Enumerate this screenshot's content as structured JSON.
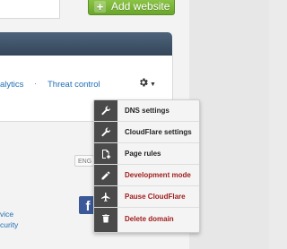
{
  "header": {
    "add_website_label": "Add website",
    "add_icon": "plus-icon"
  },
  "nav": {
    "analytics_link": "alytics",
    "separator": "·",
    "threat_control_link": "Threat control",
    "settings_icon": "gear-icon",
    "caret_icon": "chevron-down-icon"
  },
  "language_button": {
    "label": "ENG"
  },
  "footer": {
    "facebook_icon": "facebook-icon",
    "facebook_letter": "f",
    "link_1": "vice",
    "link_2": "curity"
  },
  "menu": {
    "items": [
      {
        "label": "DNS settings",
        "icon": "wrench-icon",
        "style": "normal"
      },
      {
        "label": "CloudFlare settings",
        "icon": "wrench-icon",
        "style": "normal"
      },
      {
        "label": "Page rules",
        "icon": "page-gear-icon",
        "style": "normal"
      },
      {
        "label": "Development mode",
        "icon": "pencil-icon",
        "style": "danger"
      },
      {
        "label": "Pause CloudFlare",
        "icon": "plane-icon",
        "style": "danger"
      },
      {
        "label": "Delete domain",
        "icon": "trash-icon",
        "style": "danger"
      }
    ]
  },
  "colors": {
    "accent_green": "#6aa62b",
    "header_dark": "#3f536a",
    "link_blue": "#1f6fb5",
    "danger_red": "#a11d1d",
    "menu_icon_column": "#4a4a4a"
  }
}
